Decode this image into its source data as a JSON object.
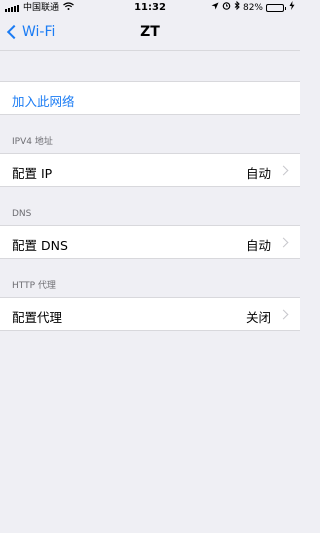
{
  "status_bar": {
    "carrier": "中国联通",
    "time": "11:32",
    "battery_percent": "82%",
    "battery_level": 0.82
  },
  "nav": {
    "back_label": "Wi-Fi",
    "title": "ZT"
  },
  "join_label": "加入此网络",
  "sections": {
    "ipv4": {
      "header": "IPV4 地址",
      "row_label": "配置 IP",
      "row_value": "自动"
    },
    "dns": {
      "header": "DNS",
      "row_label": "配置 DNS",
      "row_value": "自动"
    },
    "proxy": {
      "header": "HTTP 代理",
      "row_label": "配置代理",
      "row_value": "关闭"
    }
  },
  "icons": {
    "signal": "signal-bars-icon",
    "wifi": "wifi-icon",
    "location": "location-arrow-icon",
    "alarm": "alarm-icon",
    "bluetooth": "bluetooth-icon",
    "battery": "battery-icon",
    "charging": "charging-bolt-icon",
    "back": "chevron-left-icon",
    "disclosure": "chevron-right-icon"
  },
  "colors": {
    "accent": "#1b7cf4",
    "background": "#efeff4",
    "battery_fill": "#4cd964"
  }
}
